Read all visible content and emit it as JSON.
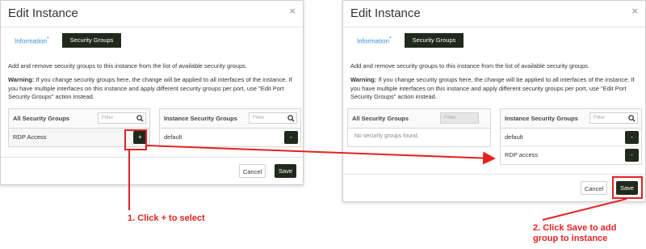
{
  "left_dialog": {
    "title": "Edit Instance",
    "close": "×",
    "tab_information": "Information",
    "tab_information_marker": "*",
    "tab_security_groups": "Security Groups",
    "description": "Add and remove security groups to this instance from the list of available security groups.",
    "warning_label": "Warning:",
    "warning_text": " If you change security groups here, the change will be applied to all interfaces of the instance. If you have multiple interfaces on this instance and apply different security groups per port, use \"Edit Port Security Groups\" action instead.",
    "all_groups_header": "All Security Groups",
    "instance_groups_header": "Instance Security Groups",
    "filter_placeholder": "Filter",
    "all_groups": [
      {
        "label": "RDP Access",
        "button": "+"
      }
    ],
    "instance_groups": [
      {
        "label": "default",
        "button": "-"
      }
    ],
    "cancel_label": "Cancel",
    "save_label": "Save"
  },
  "right_dialog": {
    "title": "Edit Instance",
    "close": "×",
    "tab_information": "Information",
    "tab_information_marker": "*",
    "tab_security_groups": "Security Groups",
    "description": "Add and remove security groups to this instance from the list of available security groups.",
    "warning_label": "Warning:",
    "warning_text": " If you change security groups here, the change will be applied to all interfaces of the instance. If you have multiple interfaces on this instance and apply different security groups per port, use \"Edit Port Security Groups\" action instead.",
    "all_groups_header": "All Security Groups",
    "instance_groups_header": "Instance Security Groups",
    "filter_placeholder": "Filter",
    "all_groups_empty": "No security groups found.",
    "instance_groups": [
      {
        "label": "default",
        "button": "-"
      },
      {
        "label": "RDP access",
        "button": "-"
      }
    ],
    "cancel_label": "Cancel",
    "save_label": "Save"
  },
  "annotations": {
    "step1": "1. Click + to select",
    "step2_line1": "2. Click Save to add",
    "step2_line2": "group to instance"
  },
  "colors": {
    "accent_dark": "#1f2a1c",
    "highlight_red": "#e32222",
    "link_blue": "#3b8fd6"
  }
}
